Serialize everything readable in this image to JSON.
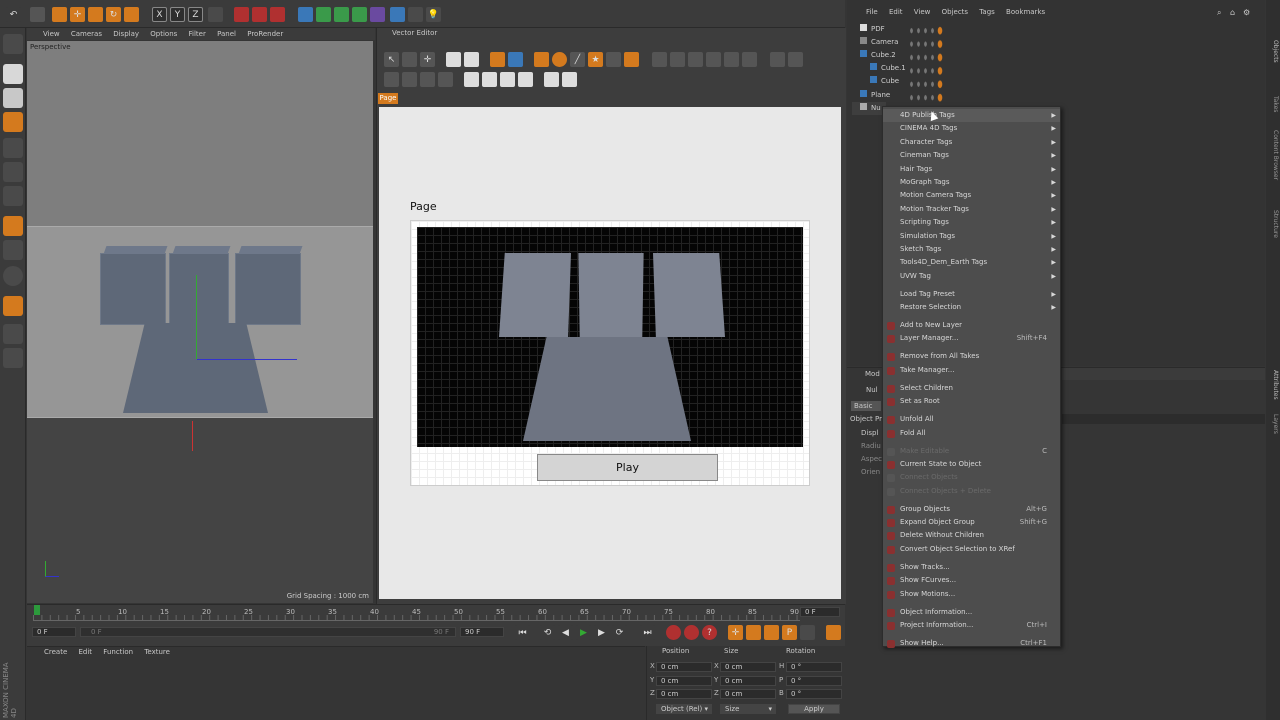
{
  "toolbar": {
    "undo_icon": "undo-icon",
    "axis_x": "X",
    "axis_y": "Y",
    "axis_z": "Z"
  },
  "viewport": {
    "menu": [
      "View",
      "Cameras",
      "Display",
      "Options",
      "Filter",
      "Panel",
      "ProRender"
    ],
    "label": "Perspective",
    "grid_spacing": "Grid Spacing : 1000 cm"
  },
  "vector_editor": {
    "title": "Vector Editor",
    "tab": "Page",
    "page_label": "Page",
    "play_button": "Play"
  },
  "object_manager": {
    "menu": [
      "File",
      "Edit",
      "View",
      "Objects",
      "Tags",
      "Bookmarks"
    ],
    "objects": [
      {
        "name": "PDF",
        "indent": 0
      },
      {
        "name": "Camera",
        "indent": 0
      },
      {
        "name": "Cube.2",
        "indent": 0
      },
      {
        "name": "Cube.1",
        "indent": 1
      },
      {
        "name": "Cube",
        "indent": 1
      },
      {
        "name": "Plane",
        "indent": 0
      },
      {
        "name": "Nu",
        "indent": 0
      }
    ]
  },
  "attributes": {
    "header": "Mod",
    "obj": "Nul",
    "tab_basic": "Basic",
    "object_props": "Object Pr",
    "rows": [
      "Displ",
      "Radiu",
      "Aspec",
      "Orien"
    ]
  },
  "context_menu": {
    "groups": [
      [
        {
          "label": "4D Publish Tags",
          "sub": true,
          "hl": true
        },
        {
          "label": "CINEMA 4D Tags",
          "sub": true
        },
        {
          "label": "Character Tags",
          "sub": true
        },
        {
          "label": "Cineman Tags",
          "sub": true
        },
        {
          "label": "Hair Tags",
          "sub": true
        },
        {
          "label": "MoGraph Tags",
          "sub": true
        },
        {
          "label": "Motion Camera Tags",
          "sub": true
        },
        {
          "label": "Motion Tracker Tags",
          "sub": true
        },
        {
          "label": "Scripting Tags",
          "sub": true
        },
        {
          "label": "Simulation Tags",
          "sub": true
        },
        {
          "label": "Sketch Tags",
          "sub": true
        },
        {
          "label": "Tools4D_Dem_Earth Tags",
          "sub": true
        },
        {
          "label": "UVW Tag",
          "sub": true
        }
      ],
      [
        {
          "label": "Load Tag Preset",
          "sub": true
        },
        {
          "label": "Restore Selection",
          "sub": true
        }
      ],
      [
        {
          "label": "Add to New Layer",
          "icon": true
        },
        {
          "label": "Layer Manager...",
          "shortcut": "Shift+F4",
          "icon": true
        }
      ],
      [
        {
          "label": "Remove from All Takes",
          "icon": true
        },
        {
          "label": "Take Manager...",
          "icon": true
        }
      ],
      [
        {
          "label": "Select Children",
          "icon": true
        },
        {
          "label": "Set as Root",
          "icon": true
        }
      ],
      [
        {
          "label": "Unfold All",
          "icon": true
        },
        {
          "label": "Fold All",
          "icon": true
        }
      ],
      [
        {
          "label": "Make Editable",
          "shortcut": "C",
          "disabled": true,
          "icon": true
        },
        {
          "label": "Current State to Object",
          "icon": true
        },
        {
          "label": "Connect Objects",
          "disabled": true,
          "icon": true
        },
        {
          "label": "Connect Objects + Delete",
          "disabled": true,
          "icon": true
        }
      ],
      [
        {
          "label": "Group Objects",
          "shortcut": "Alt+G",
          "icon": true
        },
        {
          "label": "Expand Object Group",
          "shortcut": "Shift+G",
          "icon": true
        },
        {
          "label": "Delete Without Children",
          "icon": true
        },
        {
          "label": "Convert Object Selection to XRef",
          "icon": true
        }
      ],
      [
        {
          "label": "Show Tracks...",
          "icon": true
        },
        {
          "label": "Show FCurves...",
          "icon": true
        },
        {
          "label": "Show Motions...",
          "icon": true
        }
      ],
      [
        {
          "label": "Object Information...",
          "icon": true
        },
        {
          "label": "Project Information...",
          "shortcut": "Ctrl+I",
          "icon": true
        }
      ],
      [
        {
          "label": "Show Help...",
          "shortcut": "Ctrl+F1",
          "icon": true
        }
      ]
    ]
  },
  "timeline": {
    "ticks": [
      "0",
      "5",
      "10",
      "15",
      "20",
      "25",
      "30",
      "35",
      "40",
      "45",
      "50",
      "55",
      "60",
      "65",
      "70",
      "75",
      "80",
      "85",
      "90"
    ],
    "frame_end_field": "0 F",
    "current_frame": "0 F",
    "range_start": "0 F",
    "range_end": "90 F",
    "max_frame": "90 F"
  },
  "material_manager": {
    "menu": [
      "Create",
      "Edit",
      "Function",
      "Texture"
    ]
  },
  "coordinates": {
    "headers": [
      "Position",
      "Size",
      "Rotation"
    ],
    "rows": [
      {
        "axis": "X",
        "pos": "0 cm",
        "saxis": "X",
        "size": "0 cm",
        "raxis": "H",
        "rot": "0 °"
      },
      {
        "axis": "Y",
        "pos": "0 cm",
        "saxis": "Y",
        "size": "0 cm",
        "raxis": "P",
        "rot": "0 °"
      },
      {
        "axis": "Z",
        "pos": "0 cm",
        "saxis": "Z",
        "size": "0 cm",
        "raxis": "B",
        "rot": "0 °"
      }
    ],
    "mode": "Object (Rel)",
    "size_mode": "Size",
    "apply": "Apply"
  },
  "branding": {
    "logo_text": "MAXON CINEMA 4D"
  },
  "right_tabs": [
    "Objects",
    "Takes",
    "Content Browser",
    "Structure"
  ],
  "right_tabs2": [
    "Attributes",
    "Layers"
  ],
  "colors": {
    "accent_orange": "#d47a1e",
    "menu_bg": "#4d4d4d",
    "highlight": "#5a5a5a"
  }
}
